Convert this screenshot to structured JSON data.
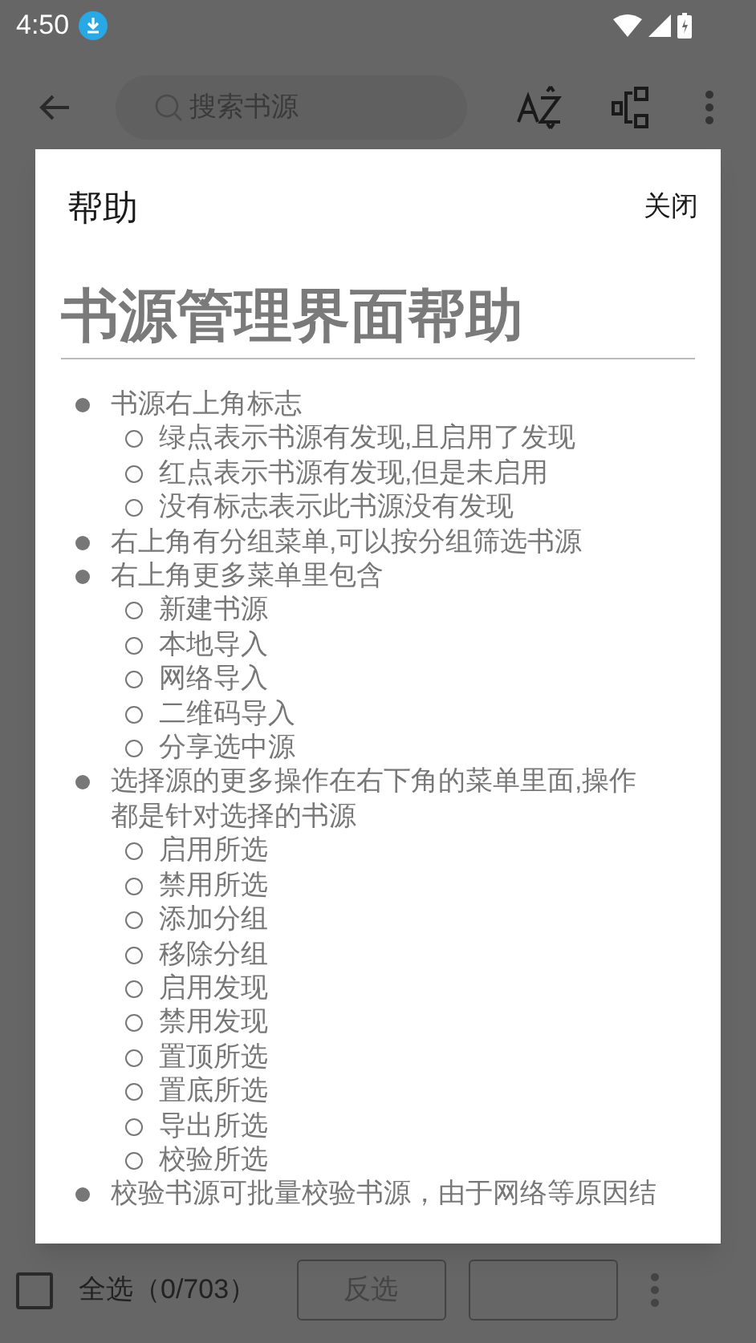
{
  "status_bar": {
    "time": "4:50"
  },
  "toolbar": {
    "search": {
      "placeholder": "搜索书源"
    }
  },
  "dialog": {
    "title": "帮助",
    "close": "关闭",
    "heading": "书源管理界面帮助",
    "items": [
      {
        "text": "书源右上角标志",
        "children": [
          {
            "text": "绿点表示书源有发现,且启用了发现"
          },
          {
            "text": "红点表示书源有发现,但是未启用"
          },
          {
            "text": "没有标志表示此书源没有发现"
          }
        ]
      },
      {
        "text": "右上角有分组菜单,可以按分组筛选书源"
      },
      {
        "text": "右上角更多菜单里包含",
        "children": [
          {
            "text": "新建书源"
          },
          {
            "text": "本地导入"
          },
          {
            "text": "网络导入"
          },
          {
            "text": "二维码导入"
          },
          {
            "text": "分享选中源"
          }
        ]
      },
      {
        "text": "选择源的更多操作在右下角的菜单里面,操作都是针对选择的书源",
        "children": [
          {
            "text": "启用所选"
          },
          {
            "text": "禁用所选"
          },
          {
            "text": "添加分组"
          },
          {
            "text": "移除分组"
          },
          {
            "text": "启用发现"
          },
          {
            "text": "禁用发现"
          },
          {
            "text": "置顶所选"
          },
          {
            "text": "置底所选"
          },
          {
            "text": "导出所选"
          },
          {
            "text": "校验所选"
          }
        ]
      },
      {
        "text": "校验书源可批量校验书源，由于网络等原因结"
      }
    ]
  },
  "bottom_bar": {
    "select_all": {
      "label": "全选（0/703）",
      "checked": false
    },
    "buttons": [
      "反选"
    ]
  }
}
